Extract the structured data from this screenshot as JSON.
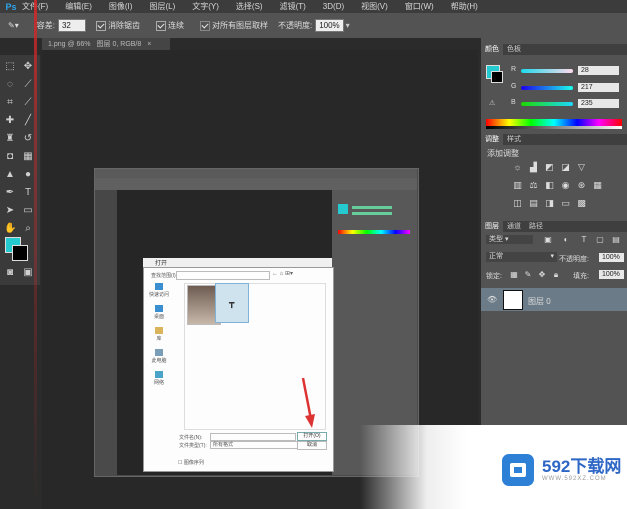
{
  "app": {
    "logo": "Ps"
  },
  "menu": [
    "文件(F)",
    "编辑(E)",
    "图像(I)",
    "图层(L)",
    "文字(Y)",
    "选择(S)",
    "滤镜(T)",
    "3D(D)",
    "视图(V)",
    "窗口(W)",
    "帮助(H)"
  ],
  "options": {
    "tool_icon": "eyedropper-icon",
    "tolerance_label": "容差:",
    "tolerance_value": "32",
    "antialias_label": "消除锯齿",
    "contiguous_label": "连续",
    "sample_all_label": "对所有图层取样",
    "opacity_label": "不透明度:",
    "opacity_value": "100%"
  },
  "document_tabs": [
    "1.png @ 66%",
    "图层 0, RGB/8"
  ],
  "colors": {
    "foreground": "#25c9d0",
    "background": "#000000",
    "accent": "#2fa3e6"
  },
  "color_panel": {
    "tabs": [
      "颜色",
      "色板"
    ],
    "r_label": "R",
    "r_value": "28",
    "g_label": "G",
    "g_value": "217",
    "b_label": "B",
    "b_value": "235"
  },
  "adjust_panel": {
    "tabs": [
      "调整",
      "样式"
    ],
    "title": "添加调整"
  },
  "layers_panel": {
    "tabs": [
      "图层",
      "通道",
      "路径"
    ],
    "kind_label": "类型",
    "blend_mode": "正常",
    "opacity_label": "不透明度:",
    "opacity_value": "100%",
    "lock_label": "锁定:",
    "fill_label": "填充:",
    "fill_value": "100%",
    "layer_name": "图层 0"
  },
  "open_dialog": {
    "title": "打开",
    "look_in_label": "查找范围(I):",
    "side_items": [
      "快速访问",
      "桌面",
      "库",
      "此电脑",
      "网络"
    ],
    "filename_label": "文件名(N):",
    "filetype_label": "文件类型(T):",
    "filetype_value": "所有格式",
    "open_button": "打开(O)",
    "cancel_button": "取消",
    "sequence_label": "图像序列"
  },
  "watermark": {
    "title": "592下载网",
    "subtitle": "WWW.592XZ.COM"
  }
}
